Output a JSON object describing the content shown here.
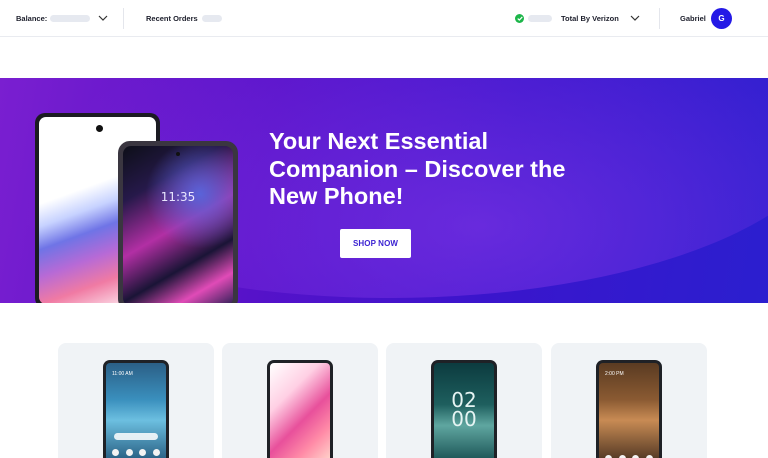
{
  "topbar": {
    "balance_label": "Balance:",
    "recent_orders_label": "Recent Orders",
    "plan_label": "Total By Verizon",
    "user_name": "Gabriel",
    "avatar_initial": "G",
    "icons": {
      "balance_toggle": "chevron-down-icon",
      "status": "check-circle-icon",
      "plan_toggle": "chevron-down-icon"
    }
  },
  "hero": {
    "title": "Your Next Essential Companion – Discover the New Phone!",
    "cta_label": "SHOP NOW",
    "phone_b_time": "11:35"
  },
  "products": [
    {
      "screen_time": "11:00 AM"
    },
    {
      "screen_time": ""
    },
    {
      "screen_clock": "02\n00"
    },
    {
      "screen_time": "2:00 PM"
    }
  ],
  "colors": {
    "brand_accent": "#2419e6",
    "hero_start": "#7a1fd0",
    "hero_end": "#2b1fcf",
    "status_green": "#1db64a",
    "card_bg": "#f0f3f6"
  }
}
